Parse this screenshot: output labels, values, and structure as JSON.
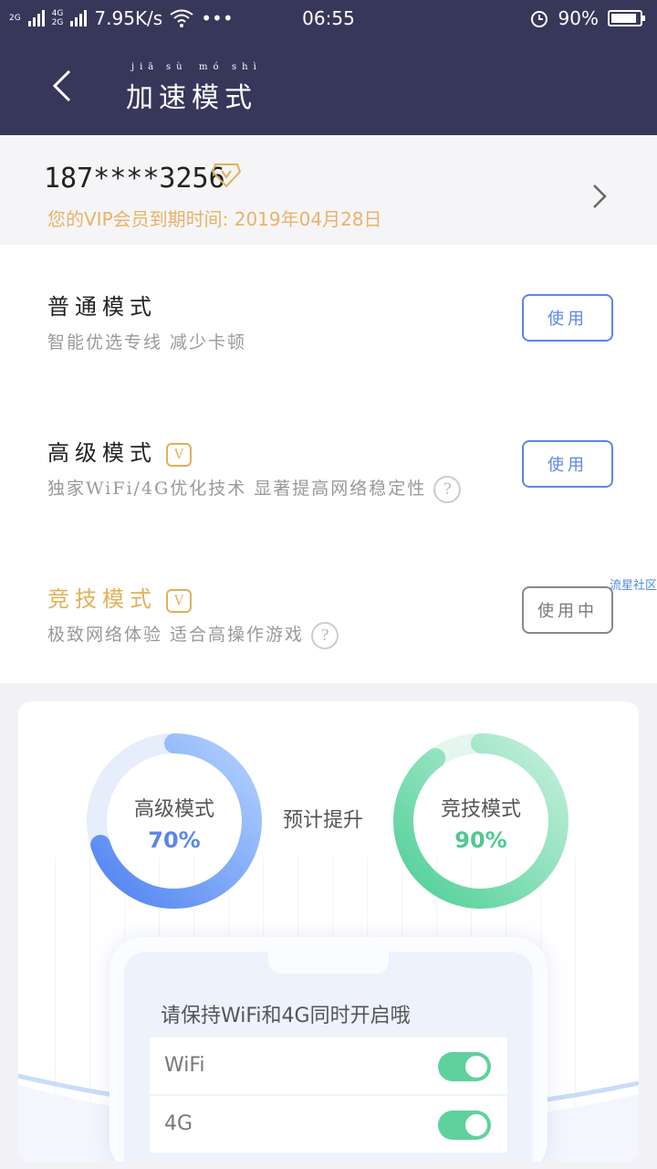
{
  "status_bar": {
    "signal_left": "2G",
    "signal_right_top": "4G",
    "signal_right_bottom": "2G",
    "speed": "7.95K/s",
    "more": "•••",
    "time": "06:55",
    "battery": "90%",
    "battery_level": 0.9
  },
  "nav": {
    "title": "加速模式",
    "title_pinyin": [
      "jiā",
      "sù",
      "mó",
      "shì"
    ]
  },
  "account": {
    "phone": "187****3256",
    "expiry": "您的VIP会员到期时间: 2019年04月28日"
  },
  "modes": [
    {
      "name": "普通模式",
      "desc": "智能优选专线 减少卡顿",
      "button": "使用",
      "vip": false,
      "help": false
    },
    {
      "name": "高级模式",
      "desc": "独家WiFi/4G优化技术 显著提高网络稳定性",
      "button": "使用",
      "vip": true,
      "help": true
    },
    {
      "name": "竞技模式",
      "desc": "极致网络体验 适合高操作游戏",
      "button": "使用中",
      "vip": true,
      "help": true
    }
  ],
  "badges": {
    "vip": "V",
    "help": "?"
  },
  "watermark": "流星社区",
  "boost": {
    "expect_label": "预计提升",
    "advanced": {
      "label": "高级模式",
      "value": "70%",
      "level": 0.7
    },
    "competitive": {
      "label": "竞技模式",
      "value": "90%",
      "level": 0.9
    }
  },
  "phone_tip": {
    "message": "请保持WiFi和4G同时开启哦",
    "wifi_label": "WiFi",
    "g4_label": "4G"
  },
  "colors": {
    "nav_bg": "#37375a",
    "blue": "#5a86e8",
    "green": "#5fd19c",
    "gold": "#e2b057"
  }
}
